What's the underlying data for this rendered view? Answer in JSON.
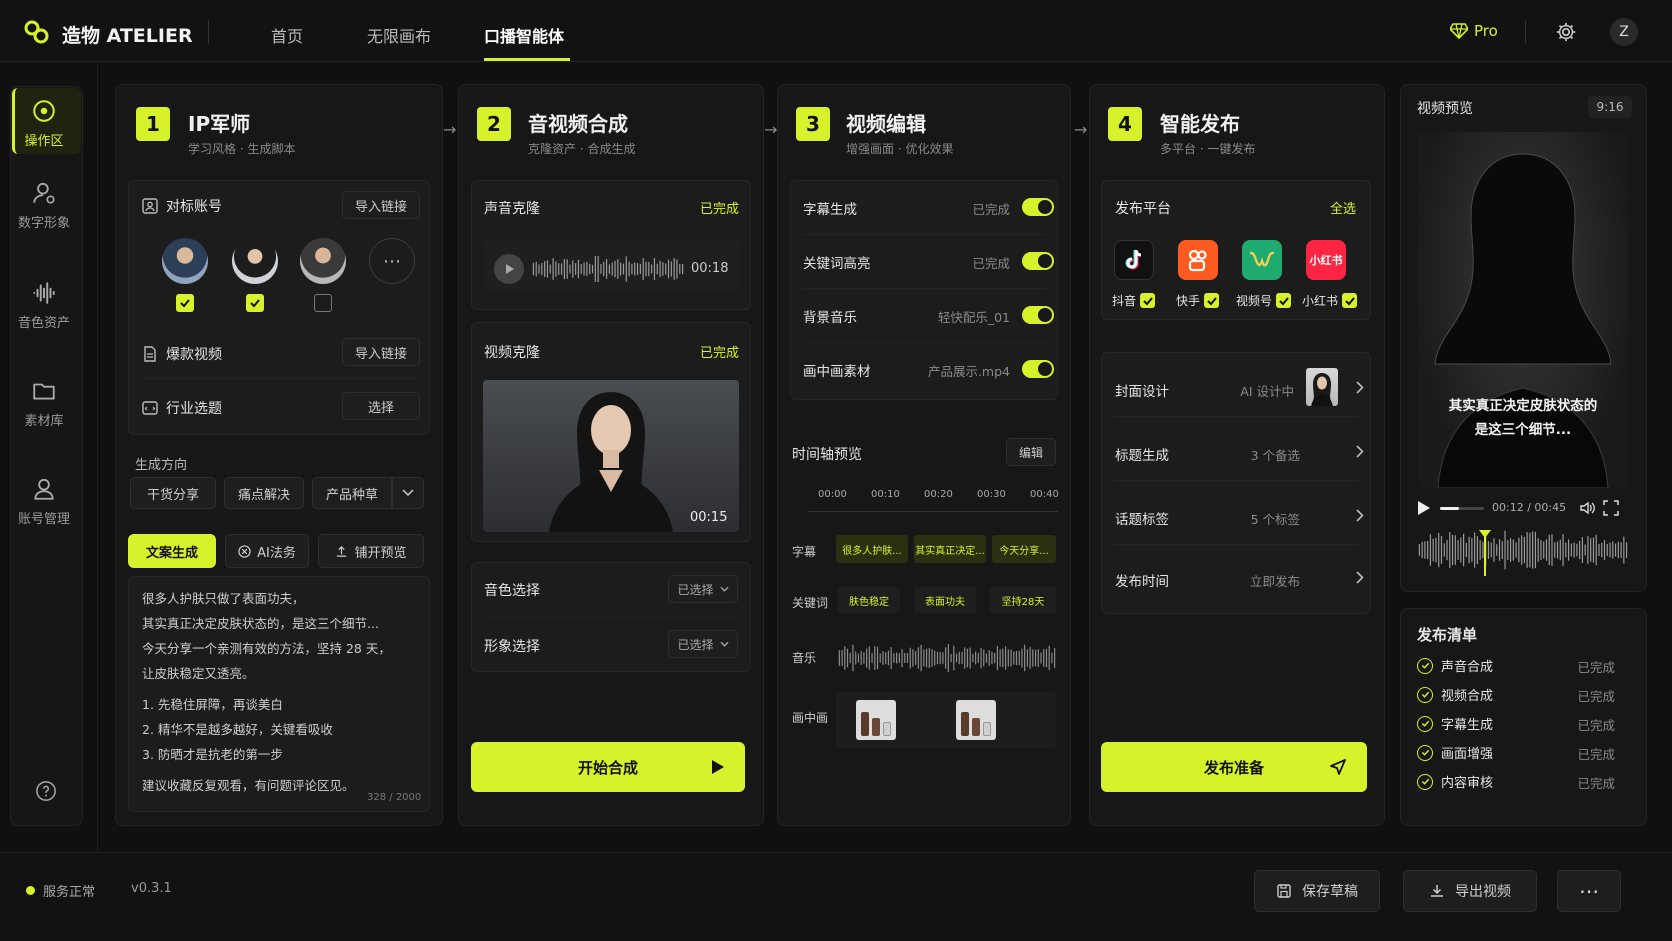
{
  "app": {
    "name": "造物 ATELIER"
  },
  "nav": {
    "tabs": [
      {
        "label": "首页"
      },
      {
        "label": "无限画布"
      },
      {
        "label": "口播智能体"
      }
    ],
    "pro": "Pro",
    "avatar": "Z"
  },
  "sidebar": {
    "items": [
      {
        "label": "操作区"
      },
      {
        "label": "数字形象"
      },
      {
        "label": "音色资产"
      },
      {
        "label": "素材库"
      },
      {
        "label": "账号管理"
      }
    ]
  },
  "step1": {
    "num": "1",
    "title": "IP军师",
    "subtitle": "学习风格 · 生成脚本",
    "benchmark": {
      "label": "对标账号",
      "button": "导入链接"
    },
    "viral": {
      "label": "爆款视频",
      "button": "导入链接"
    },
    "topic": {
      "label": "行业选题",
      "button": "选择"
    },
    "direction": {
      "label": "生成方向",
      "options": [
        "干货分享",
        "痛点解决",
        "产品种草"
      ]
    },
    "actions": {
      "generate": "文案生成",
      "ai": "AI法务",
      "preview": "铺开预览"
    },
    "script": [
      "很多人护肤只做了表面功夫，",
      "其实真正决定皮肤状态的，是这三个细节...",
      "今天分享一个亲测有效的方法，坚持 28 天，",
      "让皮肤稳定又透亮。",
      "1. 先稳住屏障，再谈美白",
      "2. 精华不是越多越好，关键看吸收",
      "3. 防晒才是抗老的第一步",
      "建议收藏反复观看，有问题评论区见。"
    ],
    "count": "328 / 2000"
  },
  "step2": {
    "num": "2",
    "title": "音视频合成",
    "subtitle": "克隆资产 · 合成生成",
    "voice": {
      "label": "声音克隆",
      "status": "已完成",
      "time": "00:18"
    },
    "video": {
      "label": "视频克隆",
      "status": "已完成",
      "time": "00:15"
    },
    "tone": {
      "label": "音色选择",
      "value": "已选择"
    },
    "avatar": {
      "label": "形象选择",
      "value": "已选择"
    },
    "start": "开始合成"
  },
  "step3": {
    "num": "3",
    "title": "视频编辑",
    "subtitle": "增强画面 · 优化效果",
    "rows": [
      {
        "label": "字幕生成",
        "value": "已完成"
      },
      {
        "label": "关键词高亮",
        "value": "已完成"
      },
      {
        "label": "背景音乐",
        "value": "轻快配乐_01"
      },
      {
        "label": "画中画素材",
        "value": "产品展示.mp4"
      }
    ],
    "timeline": {
      "label": "时间轴预览",
      "edit": "编辑",
      "ticks": [
        "00:00",
        "00:10",
        "00:20",
        "00:30",
        "00:40"
      ],
      "subtitle_label": "字幕",
      "subtitle_chips": [
        "很多人护肤...",
        "其实真正决定...",
        "今天分享..."
      ],
      "keyword_label": "关键词",
      "keyword_chips": [
        "肤色稳定",
        "表面功夫",
        "坚持28天"
      ],
      "music_label": "音乐",
      "pip_label": "画中画"
    }
  },
  "step4": {
    "num": "4",
    "title": "智能发布",
    "subtitle": "多平台 · 一键发布",
    "platforms": {
      "label": "发布平台",
      "all": "全选",
      "items": [
        {
          "name": "抖音"
        },
        {
          "name": "快手"
        },
        {
          "name": "视频号"
        },
        {
          "name": "小红书",
          "logo": "小红书"
        }
      ]
    },
    "rows": [
      {
        "label": "封面设计",
        "value": "AI 设计中"
      },
      {
        "label": "标题生成",
        "value": "3 个备选"
      },
      {
        "label": "话题标签",
        "value": "5 个标签"
      },
      {
        "label": "发布时间",
        "value": "立即发布"
      }
    ],
    "publish": "发布准备"
  },
  "preview": {
    "title": "视频预览",
    "ratio": "9:16",
    "caption": [
      "其实真正决定皮肤状态的",
      "是这三个细节..."
    ],
    "time": "00:12 / 00:45",
    "progress": 0.27
  },
  "checklist": {
    "title": "发布清单",
    "items": [
      {
        "label": "声音合成",
        "status": "已完成"
      },
      {
        "label": "视频合成",
        "status": "已完成"
      },
      {
        "label": "字幕生成",
        "status": "已完成"
      },
      {
        "label": "画面增强",
        "status": "已完成"
      },
      {
        "label": "内容审核",
        "status": "已完成"
      }
    ]
  },
  "footer": {
    "status": "服务正常",
    "version": "v0.3.1",
    "save": "保存草稿",
    "export": "导出视频"
  },
  "colors": {
    "accent": "#d7f22a",
    "bg": "#101010"
  }
}
